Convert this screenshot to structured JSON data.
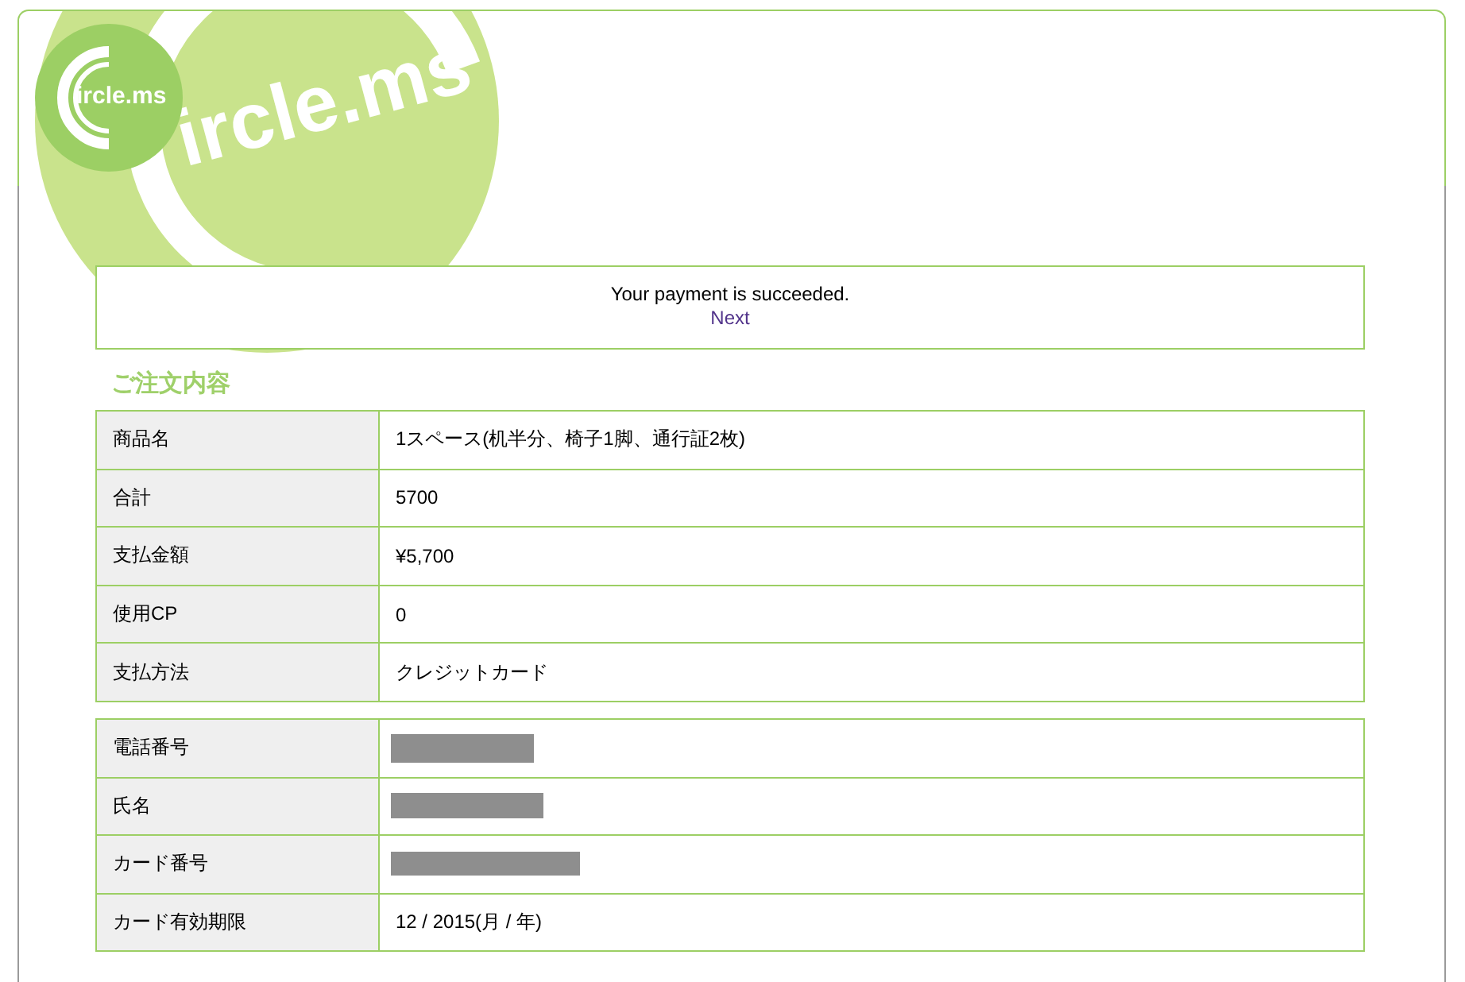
{
  "header": {
    "logo_text": "ircle.ms",
    "background_text": "ircle.ms"
  },
  "message": {
    "text": "Your payment is succeeded.",
    "link": "Next"
  },
  "order": {
    "title": "ご注文内容",
    "rows": [
      {
        "label": "商品名",
        "value": "1スペース(机半分、椅子1脚、通行証2枚)"
      },
      {
        "label": "合計",
        "value": "5700"
      },
      {
        "label": "支払金額",
        "value": "¥5,700"
      },
      {
        "label": "使用CP",
        "value": "0"
      },
      {
        "label": "支払方法",
        "value": "クレジットカード"
      }
    ]
  },
  "contact": {
    "rows": [
      {
        "label": "電話番号",
        "kind": "redacted"
      },
      {
        "label": "氏名",
        "kind": "redacted"
      },
      {
        "label": "カード番号",
        "kind": "redacted"
      },
      {
        "label": "カード有効期限",
        "kind": "text",
        "value": "12 / 2015(月 / 年)"
      }
    ]
  }
}
